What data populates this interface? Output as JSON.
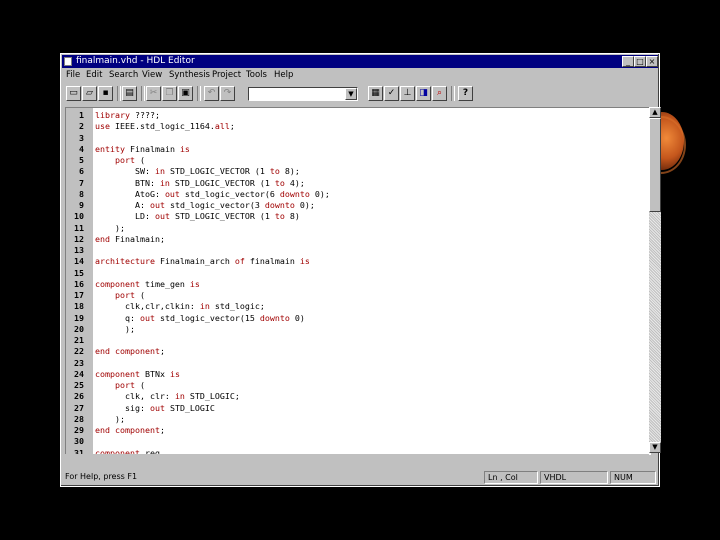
{
  "window": {
    "title": "finalmain.vhd - HDL Editor",
    "controls": {
      "minimize": "_",
      "maximize": "□",
      "close": "×"
    }
  },
  "menu": [
    "File",
    "Edit",
    "Search",
    "View",
    "Synthesis",
    "Project",
    "Tools",
    "Help"
  ],
  "toolbar": {
    "buttons": [
      {
        "name": "new-icon",
        "glyph": "▭"
      },
      {
        "name": "open-icon",
        "glyph": "▱"
      },
      {
        "name": "save-icon",
        "glyph": "▪"
      },
      {
        "name": "print-icon",
        "glyph": "▤"
      },
      {
        "name": "cut-icon",
        "glyph": "✂"
      },
      {
        "name": "copy-icon",
        "glyph": "❐"
      },
      {
        "name": "paste-icon",
        "glyph": "▣"
      },
      {
        "name": "undo-icon",
        "glyph": "↶"
      },
      {
        "name": "redo-icon",
        "glyph": "↷"
      },
      {
        "name": "language-assistant-icon",
        "glyph": "▦"
      },
      {
        "name": "syntax-check-icon",
        "glyph": "✓"
      },
      {
        "name": "synthesize-icon",
        "glyph": "⊥"
      },
      {
        "name": "bookmark-icon",
        "glyph": "◨"
      },
      {
        "name": "find-icon",
        "glyph": "⌕"
      },
      {
        "name": "help-icon",
        "glyph": "?"
      }
    ],
    "combo_value": "",
    "combo_arrow": "▼"
  },
  "code_lines": [
    {
      "n": "1",
      "tokens": [
        {
          "t": "library",
          "k": true
        },
        {
          "t": " ????;",
          "k": false
        }
      ]
    },
    {
      "n": "2",
      "tokens": [
        {
          "t": "use",
          "k": true
        },
        {
          "t": " IEEE.std_logic_1164.",
          "k": false
        },
        {
          "t": "all",
          "k": true
        },
        {
          "t": ";",
          "k": false
        }
      ]
    },
    {
      "n": "3",
      "tokens": []
    },
    {
      "n": "4",
      "tokens": [
        {
          "t": "entity",
          "k": true
        },
        {
          "t": " Finalmain ",
          "k": false
        },
        {
          "t": "is",
          "k": true
        }
      ]
    },
    {
      "n": "5",
      "tokens": [
        {
          "t": "    port",
          "k": true
        },
        {
          "t": " (",
          "k": false
        }
      ]
    },
    {
      "n": "6",
      "tokens": [
        {
          "t": "        SW: ",
          "k": false
        },
        {
          "t": "in",
          "k": true
        },
        {
          "t": " STD_LOGIC_VECTOR (1 ",
          "k": false
        },
        {
          "t": "to",
          "k": true
        },
        {
          "t": " 8);",
          "k": false
        }
      ]
    },
    {
      "n": "7",
      "tokens": [
        {
          "t": "        BTN: ",
          "k": false
        },
        {
          "t": "in",
          "k": true
        },
        {
          "t": " STD_LOGIC_VECTOR (1 ",
          "k": false
        },
        {
          "t": "to",
          "k": true
        },
        {
          "t": " 4);",
          "k": false
        }
      ]
    },
    {
      "n": "8",
      "tokens": [
        {
          "t": "        AtoG: ",
          "k": false
        },
        {
          "t": "out",
          "k": true
        },
        {
          "t": " std_logic_vector(6 ",
          "k": false
        },
        {
          "t": "downto",
          "k": true
        },
        {
          "t": " 0);",
          "k": false
        }
      ]
    },
    {
      "n": "9",
      "tokens": [
        {
          "t": "        A: ",
          "k": false
        },
        {
          "t": "out",
          "k": true
        },
        {
          "t": " std_logic_vector(3 ",
          "k": false
        },
        {
          "t": "downto",
          "k": true
        },
        {
          "t": " 0);",
          "k": false
        }
      ]
    },
    {
      "n": "10",
      "tokens": [
        {
          "t": "        LD: ",
          "k": false
        },
        {
          "t": "out",
          "k": true
        },
        {
          "t": " STD_LOGIC_VECTOR (1 ",
          "k": false
        },
        {
          "t": "to",
          "k": true
        },
        {
          "t": " 8)",
          "k": false
        }
      ]
    },
    {
      "n": "11",
      "tokens": [
        {
          "t": "    );",
          "k": false
        }
      ]
    },
    {
      "n": "12",
      "tokens": [
        {
          "t": "end",
          "k": true
        },
        {
          "t": " Finalmain;",
          "k": false
        }
      ]
    },
    {
      "n": "13",
      "tokens": []
    },
    {
      "n": "14",
      "tokens": [
        {
          "t": "architecture",
          "k": true
        },
        {
          "t": " Finalmain_arch ",
          "k": false
        },
        {
          "t": "of",
          "k": true
        },
        {
          "t": " finalmain ",
          "k": false
        },
        {
          "t": "is",
          "k": true
        }
      ]
    },
    {
      "n": "15",
      "tokens": []
    },
    {
      "n": "16",
      "tokens": [
        {
          "t": "component",
          "k": true
        },
        {
          "t": " time_gen ",
          "k": false
        },
        {
          "t": "is",
          "k": true
        }
      ]
    },
    {
      "n": "17",
      "tokens": [
        {
          "t": "    port",
          "k": true
        },
        {
          "t": " (",
          "k": false
        }
      ]
    },
    {
      "n": "18",
      "tokens": [
        {
          "t": "      clk,clr,clkin: ",
          "k": false
        },
        {
          "t": "in",
          "k": true
        },
        {
          "t": " std_logic;",
          "k": false
        }
      ]
    },
    {
      "n": "19",
      "tokens": [
        {
          "t": "      q: ",
          "k": false
        },
        {
          "t": "out",
          "k": true
        },
        {
          "t": " std_logic_vector(15 ",
          "k": false
        },
        {
          "t": "downto",
          "k": true
        },
        {
          "t": " 0)",
          "k": false
        }
      ]
    },
    {
      "n": "20",
      "tokens": [
        {
          "t": "      );",
          "k": false
        }
      ]
    },
    {
      "n": "21",
      "tokens": []
    },
    {
      "n": "22",
      "tokens": [
        {
          "t": "end component",
          "k": true
        },
        {
          "t": ";",
          "k": false
        }
      ]
    },
    {
      "n": "23",
      "tokens": []
    },
    {
      "n": "24",
      "tokens": [
        {
          "t": "component",
          "k": true
        },
        {
          "t": " BTNx ",
          "k": false
        },
        {
          "t": "is",
          "k": true
        }
      ]
    },
    {
      "n": "25",
      "tokens": [
        {
          "t": "    port",
          "k": true
        },
        {
          "t": " (",
          "k": false
        }
      ]
    },
    {
      "n": "26",
      "tokens": [
        {
          "t": "      clk, clr: ",
          "k": false
        },
        {
          "t": "in",
          "k": true
        },
        {
          "t": " STD_LOGIC;",
          "k": false
        }
      ]
    },
    {
      "n": "27",
      "tokens": [
        {
          "t": "      sig: ",
          "k": false
        },
        {
          "t": "out",
          "k": true
        },
        {
          "t": " STD_LOGIC",
          "k": false
        }
      ]
    },
    {
      "n": "28",
      "tokens": [
        {
          "t": "    );",
          "k": false
        }
      ]
    },
    {
      "n": "29",
      "tokens": [
        {
          "t": "end component",
          "k": true
        },
        {
          "t": ";",
          "k": false
        }
      ]
    },
    {
      "n": "30",
      "tokens": []
    },
    {
      "n": "31",
      "tokens": [
        {
          "t": "component",
          "k": true
        },
        {
          "t": " reg",
          "k": false
        }
      ]
    }
  ],
  "scroll": {
    "up": "▲",
    "down": "▼"
  },
  "status": {
    "help": "For Help, press F1",
    "position": "Ln , Col",
    "language": "VHDL",
    "num": "NUM"
  }
}
